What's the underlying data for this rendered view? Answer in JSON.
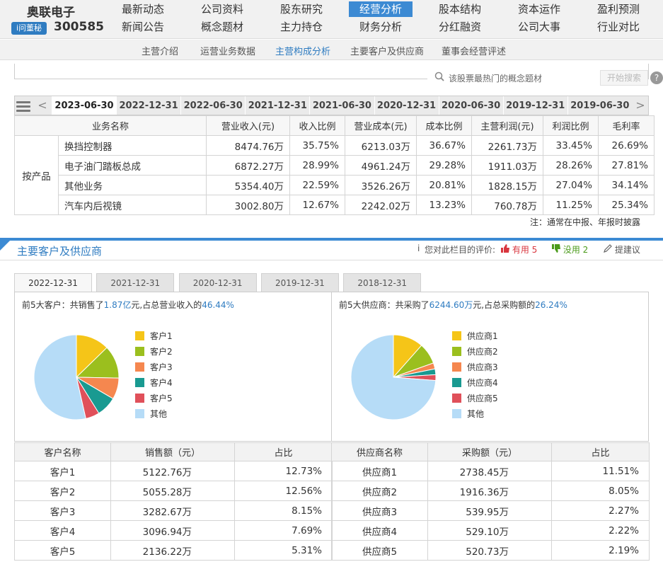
{
  "header": {
    "stock_name": "奥联电子",
    "ask_badge": "i问董秘",
    "stock_code": "300585",
    "nav_row1": [
      "最新动态",
      "公司资料",
      "股东研究",
      "经营分析",
      "股本结构",
      "资本运作",
      "盈利预测"
    ],
    "nav_row2": [
      "新闻公告",
      "概念题材",
      "主力持仓",
      "财务分析",
      "分红融资",
      "公司大事",
      "行业对比"
    ],
    "active_nav": "经营分析"
  },
  "subnav": {
    "items": [
      "主营介绍",
      "运营业务数据",
      "主营构成分析",
      "主要客户及供应商",
      "董事会经营评述"
    ],
    "active": "主营构成分析"
  },
  "concept_search": {
    "placeholder": "该股票最热门的概念题材",
    "button": "开始搜索",
    "help": "?"
  },
  "date_tabs": {
    "items": [
      "2023-06-30",
      "2022-12-31",
      "2022-06-30",
      "2021-12-31",
      "2021-06-30",
      "2020-12-31",
      "2020-06-30",
      "2019-12-31",
      "2019-06-30"
    ],
    "active": "2023-06-30",
    "prev": "<",
    "next": ">"
  },
  "composition_table": {
    "headers": [
      "业务名称",
      "营业收入(元)",
      "收入比例",
      "营业成本(元)",
      "成本比例",
      "主营利润(元)",
      "利润比例",
      "毛利率"
    ],
    "category": "按产品",
    "rows": [
      [
        "换挡控制器",
        "8474.76万",
        "35.75%",
        "6213.03万",
        "36.67%",
        "2261.73万",
        "33.45%",
        "26.69%"
      ],
      [
        "电子油门踏板总成",
        "6872.27万",
        "28.99%",
        "4961.24万",
        "29.28%",
        "1911.03万",
        "28.26%",
        "27.81%"
      ],
      [
        "其他业务",
        "5354.40万",
        "22.59%",
        "3526.26万",
        "20.81%",
        "1828.15万",
        "27.04%",
        "34.14%"
      ],
      [
        "汽车内后视镜",
        "3002.80万",
        "12.67%",
        "2242.02万",
        "13.23%",
        "760.78万",
        "11.25%",
        "25.34%"
      ]
    ],
    "note": "注：通常在中报、年报时披露"
  },
  "section2": {
    "title": "主要客户及供应商",
    "rating_label": "您对此栏目的评价:",
    "useful_label": "有用",
    "useful_count": "5",
    "useless_label": "没用",
    "useless_count": "2",
    "suggest_label": "提建议",
    "tabs": [
      "2022-12-31",
      "2021-12-31",
      "2020-12-31",
      "2019-12-31",
      "2018-12-31"
    ],
    "active_tab": "2022-12-31"
  },
  "customers": {
    "summary_prefix": "前5大客户：共销售了",
    "summary_amount": "1.87亿",
    "summary_mid": "元,占总营业收入的",
    "summary_pct": "46.44%",
    "table_headers": [
      "客户名称",
      "销售额（元）",
      "占比"
    ],
    "rows": [
      [
        "客户1",
        "5122.76万",
        "12.73%"
      ],
      [
        "客户2",
        "5055.28万",
        "12.56%"
      ],
      [
        "客户3",
        "3282.67万",
        "8.15%"
      ],
      [
        "客户4",
        "3096.94万",
        "7.69%"
      ],
      [
        "客户5",
        "2136.22万",
        "5.31%"
      ]
    ]
  },
  "suppliers": {
    "summary_prefix": "前5大供应商：共采购了",
    "summary_amount": "6244.60万",
    "summary_mid": "元,占总采购额的",
    "summary_pct": "26.24%",
    "table_headers": [
      "供应商名称",
      "采购额（元）",
      "占比"
    ],
    "rows": [
      [
        "供应商1",
        "2738.45万",
        "11.51%"
      ],
      [
        "供应商2",
        "1916.36万",
        "8.05%"
      ],
      [
        "供应商3",
        "539.95万",
        "2.27%"
      ],
      [
        "供应商4",
        "529.10万",
        "2.22%"
      ],
      [
        "供应商5",
        "520.73万",
        "2.19%"
      ]
    ]
  },
  "chart_data": [
    {
      "type": "pie",
      "categories": [
        "客户1",
        "客户2",
        "客户3",
        "客户4",
        "客户5",
        "其他"
      ],
      "values": [
        12.73,
        12.56,
        8.15,
        7.69,
        5.31,
        53.56
      ],
      "colors": [
        "#f5c518",
        "#9bbf1e",
        "#f5874f",
        "#199a91",
        "#e0505a",
        "#b6dcf7"
      ],
      "legend_position": "right"
    },
    {
      "type": "pie",
      "categories": [
        "供应商1",
        "供应商2",
        "供应商3",
        "供应商4",
        "供应商5",
        "其他"
      ],
      "values": [
        11.51,
        8.05,
        2.27,
        2.22,
        2.19,
        73.76
      ],
      "colors": [
        "#f5c518",
        "#9bbf1e",
        "#f5874f",
        "#199a91",
        "#e0505a",
        "#b6dcf7"
      ],
      "legend_position": "right"
    }
  ]
}
